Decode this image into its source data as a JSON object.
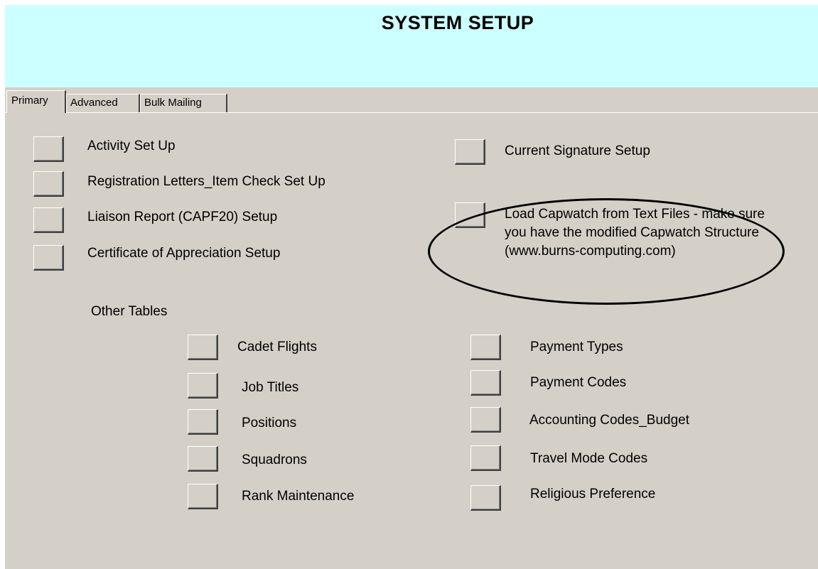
{
  "header": {
    "title": "SYSTEM SETUP"
  },
  "tabs": [
    {
      "label": "Primary",
      "selected": true
    },
    {
      "label": "Advanced",
      "selected": false
    },
    {
      "label": "Bulk Mailing",
      "selected": false
    }
  ],
  "setup_items": {
    "activity": "Activity Set Up",
    "registration": "Registration Letters_Item Check Set Up",
    "liaison": "Liaison Report (CAPF20) Setup",
    "certificate": "Certificate of  Appreciation Setup",
    "signature": "Current Signature Setup",
    "capwatch": "Load Capwatch from Text Files - make sure you have the modified Capwatch Structure (www.burns-computing.com)"
  },
  "other_tables": {
    "heading": "Other Tables",
    "left": {
      "cadet_flights": "Cadet Flights",
      "job_titles": "Job Titles",
      "positions": "Positions",
      "squadrons": "Squadrons",
      "rank": "Rank Maintenance"
    },
    "right": {
      "payment_types": "Payment Types",
      "payment_codes": "Payment Codes",
      "accounting": "Accounting Codes_Budget",
      "travel": "Travel Mode Codes",
      "religious": "Religious Preference"
    }
  },
  "colors": {
    "header_bg": "#ccffff",
    "window_bg": "#d4d0c8"
  }
}
